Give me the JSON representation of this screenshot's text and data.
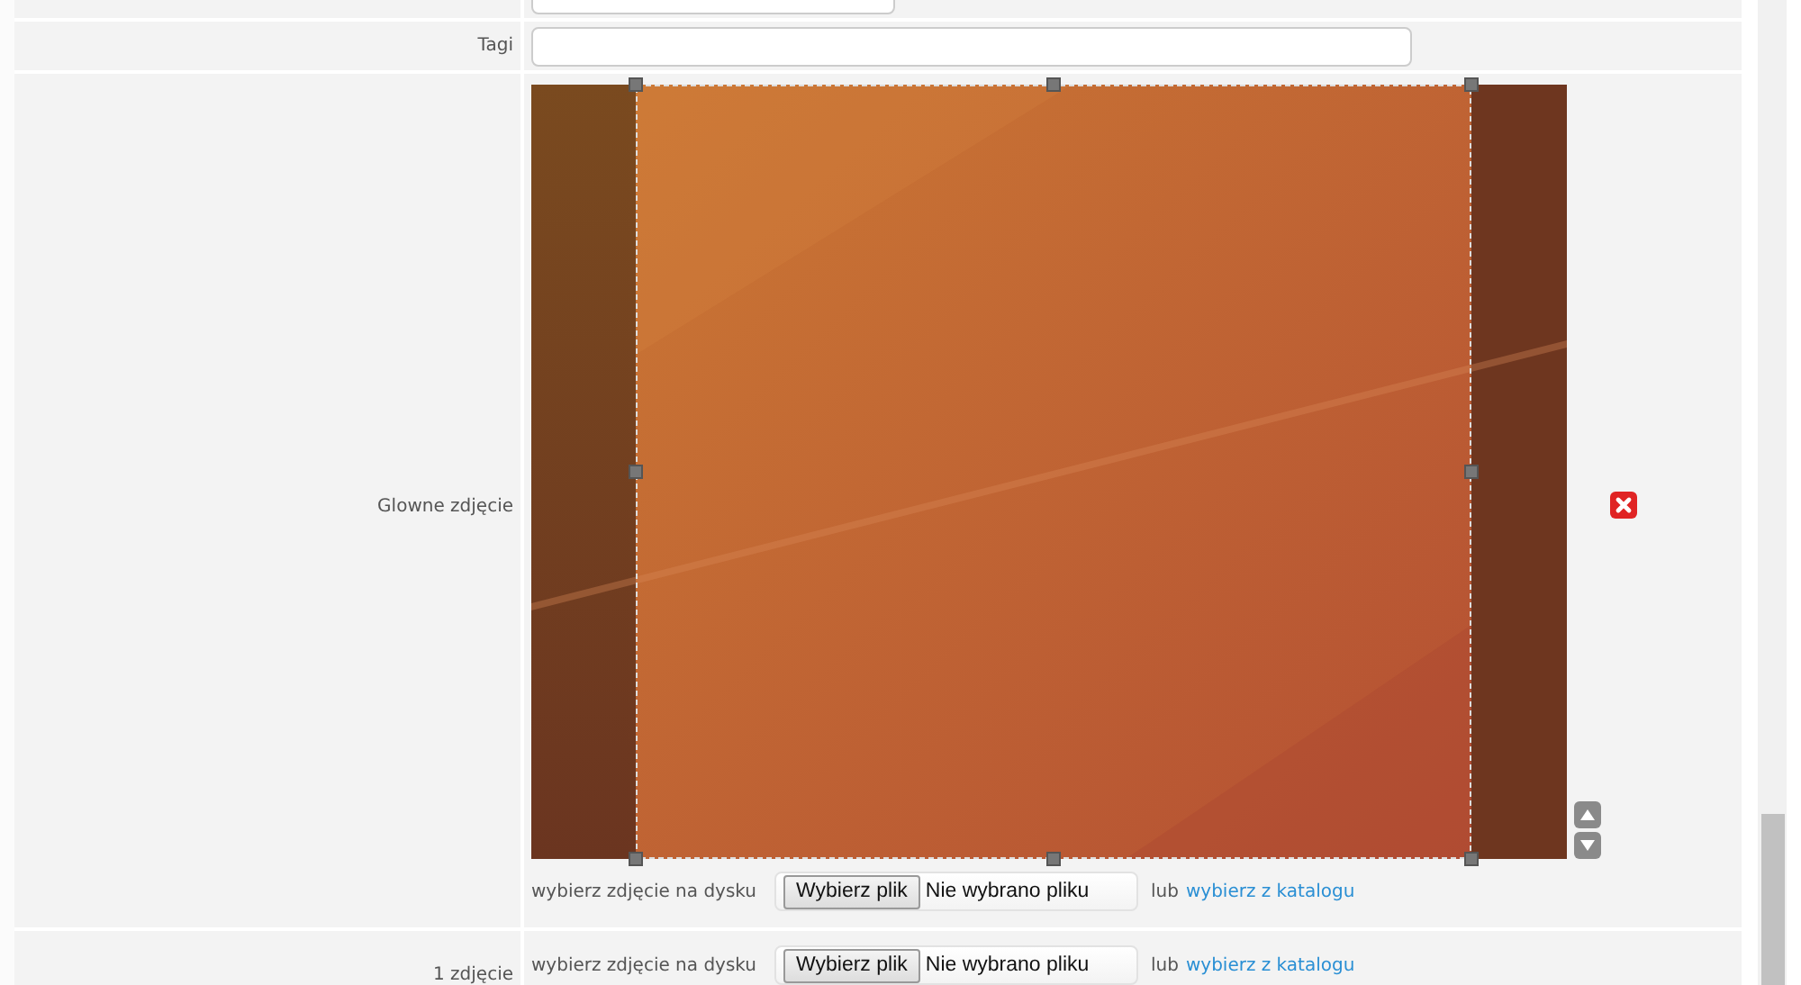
{
  "rows": [
    {
      "kind": "partial"
    },
    {
      "kind": "text",
      "label": "Tagi"
    },
    {
      "kind": "main_photo",
      "label": "Glowne zdjęcie",
      "upload": {
        "hint": "wybierz zdjęcie na dysku",
        "button": "Wybierz plik",
        "status": "Nie wybrano pliku",
        "or": "lub",
        "link": "wybierz z katalogu"
      }
    },
    {
      "label": "1 zdjęcie",
      "upload": {
        "hint": "wybierz zdjęcie na dysku",
        "button": "Wybierz plik",
        "status": "Nie wybrano pliku",
        "or": "lub",
        "link": "wybierz z katalogu"
      }
    }
  ]
}
